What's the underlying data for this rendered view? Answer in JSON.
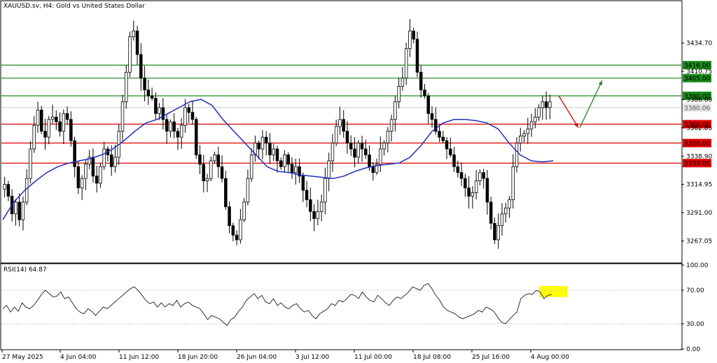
{
  "chart_title": "XAUUSD.sv, H4:  Gold vs United States Dollar",
  "rsi_title": "RSI(14) 64.87",
  "colors": {
    "background": "#ffffff",
    "candle": "#000000",
    "ma_line": "#1f2fbf",
    "support_line": "#e00000",
    "resistance_line": "#1a8a1a",
    "current_price_line": "#c0c0c0",
    "forecast_down_arrow": "#e00000",
    "forecast_up_arrow": "#1a8a1a",
    "rsi_highlight": "#ffff00",
    "rsi_line": "#000000",
    "grid_dotted": "#c8c8c8"
  },
  "chart_data": [
    {
      "type": "candlestick",
      "title": "XAUUSD.sv, H4:  Gold vs United States Dollar",
      "y_ticks": [
        3267.05,
        3291.0,
        3314.95,
        3338.9,
        3362.85,
        3386.8,
        3410.75,
        3434.7
      ],
      "ylim": [
        3249,
        3470
      ],
      "x_tick_labels": [
        "27 May 2025",
        "4 Jun 04:00",
        "11 Jun 12:00",
        "18 Jun 20:00",
        "26 Jun 04:00",
        "3 Jul 12:00",
        "11 Jul 00:00",
        "18 Jul 08:00",
        "25 Jul 16:00",
        "4 Aug 00:00"
      ],
      "approx_close_path": [
        3315,
        3305,
        3290,
        3300,
        3285,
        3300,
        3320,
        3345,
        3365,
        3378,
        3360,
        3355,
        3370,
        3372,
        3368,
        3360,
        3375,
        3370,
        3352,
        3330,
        3312,
        3320,
        3332,
        3338,
        3322,
        3316,
        3330,
        3345,
        3340,
        3330,
        3338,
        3360,
        3385,
        3410,
        3440,
        3445,
        3425,
        3405,
        3395,
        3390,
        3388,
        3375,
        3380,
        3370,
        3360,
        3368,
        3360,
        3355,
        3365,
        3380,
        3376,
        3370,
        3340,
        3332,
        3318,
        3320,
        3335,
        3340,
        3330,
        3320,
        3296,
        3280,
        3272,
        3268,
        3285,
        3300,
        3320,
        3340,
        3350,
        3345,
        3355,
        3350,
        3340,
        3345,
        3335,
        3330,
        3340,
        3332,
        3325,
        3330,
        3322,
        3310,
        3302,
        3292,
        3286,
        3292,
        3300,
        3320,
        3335,
        3350,
        3364,
        3370,
        3360,
        3350,
        3345,
        3338,
        3350,
        3345,
        3340,
        3330,
        3325,
        3332,
        3345,
        3350,
        3360,
        3370,
        3385,
        3398,
        3405,
        3430,
        3445,
        3438,
        3410,
        3395,
        3390,
        3375,
        3370,
        3360,
        3355,
        3352,
        3345,
        3340,
        3330,
        3325,
        3320,
        3312,
        3305,
        3308,
        3318,
        3325,
        3320,
        3300,
        3282,
        3268,
        3280,
        3290,
        3295,
        3302,
        3330,
        3350,
        3356,
        3358,
        3362,
        3368,
        3372,
        3380,
        3385,
        3380,
        3385
      ],
      "ma_path_approx": [
        3285,
        3300,
        3310,
        3318,
        3325,
        3330,
        3333,
        3335,
        3337,
        3340,
        3345,
        3352,
        3360,
        3367,
        3370,
        3375,
        3380,
        3385,
        3387,
        3382,
        3370,
        3360,
        3350,
        3340,
        3330,
        3326,
        3325,
        3323,
        3322,
        3321,
        3320,
        3322,
        3326,
        3329,
        3331,
        3332,
        3333,
        3338,
        3348,
        3360,
        3367,
        3370,
        3370,
        3369,
        3367,
        3362,
        3350,
        3340,
        3335,
        3334,
        3335
      ],
      "levels": [
        {
          "label": "3416.00",
          "kind": "resistance",
          "value": 3416.0
        },
        {
          "label": "3405.00",
          "kind": "resistance",
          "value": 3405.0
        },
        {
          "label": "3390.00",
          "kind": "resistance",
          "value": 3390.0
        },
        {
          "label": "3380.06",
          "kind": "current",
          "value": 3380.06
        },
        {
          "label": "3366.00",
          "kind": "support",
          "value": 3366.0
        },
        {
          "label": "3350.00",
          "kind": "support",
          "value": 3350.0
        },
        {
          "label": "3333.00",
          "kind": "support",
          "value": 3333.0
        }
      ],
      "forecast": {
        "down_arrow": {
          "from": 3390,
          "to": 3363
        },
        "up_arrow": {
          "from": 3363,
          "to": 3403
        }
      }
    },
    {
      "type": "line",
      "title": "RSI(14) 64.87",
      "y_ticks": [
        0.0,
        30.0,
        70.0,
        100.0
      ],
      "ylim": [
        0,
        100
      ],
      "series": [
        {
          "name": "RSI(14)",
          "values": [
            48,
            52,
            44,
            50,
            45,
            55,
            50,
            48,
            52,
            58,
            65,
            70,
            66,
            62,
            63,
            68,
            60,
            62,
            55,
            48,
            44,
            42,
            48,
            45,
            40,
            45,
            50,
            48,
            52,
            56,
            60,
            64,
            68,
            72,
            74,
            70,
            64,
            58,
            54,
            56,
            50,
            55,
            50,
            54,
            52,
            58,
            50,
            54,
            56,
            52,
            50,
            48,
            42,
            35,
            40,
            38,
            36,
            32,
            28,
            35,
            38,
            45,
            50,
            58,
            62,
            66,
            60,
            64,
            56,
            54,
            60,
            52,
            55,
            50,
            48,
            52,
            54,
            48,
            44,
            46,
            40,
            36,
            42,
            45,
            48,
            54,
            52,
            58,
            56,
            60,
            65,
            64,
            60,
            68,
            62,
            58,
            56,
            64,
            60,
            55,
            52,
            58,
            62,
            60,
            64,
            68,
            74,
            72,
            70,
            76,
            78,
            72,
            64,
            58,
            50,
            46,
            44,
            42,
            38,
            36,
            38,
            40,
            42,
            46,
            44,
            50,
            48,
            45,
            38,
            32,
            30,
            35,
            40,
            44,
            60,
            64,
            66,
            65,
            70,
            68,
            60,
            64,
            65
          ]
        }
      ],
      "highlight": {
        "from": 62,
        "to": 75
      }
    }
  ]
}
